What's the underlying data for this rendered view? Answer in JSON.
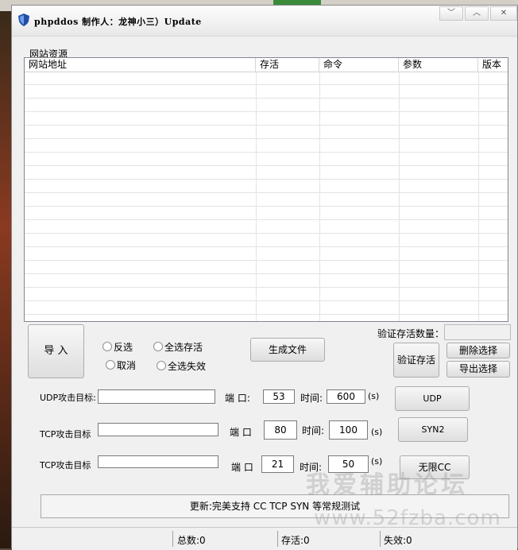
{
  "window": {
    "title": "phpddos 制作人：龙神小三）Update",
    "controls": [
      "minimize",
      "maximize",
      "close"
    ],
    "control_symbols": {
      "minimize": "﹀",
      "maximize": "︿",
      "close": "✕"
    }
  },
  "sites": {
    "group_label": "网站资源",
    "columns": [
      "网站地址",
      "存活",
      "命令",
      "参数",
      "版本"
    ],
    "rows": []
  },
  "actions": {
    "import": "导 入",
    "invert_select": "反选",
    "select_all_alive": "全选存活",
    "cancel": "取消",
    "select_all_failed": "全选失效",
    "generate_file": "生成文件",
    "verify_count_label": "验证存活数量：",
    "verify_count_value": "",
    "verify_alive": "验证存活",
    "delete_selected": "删除选择",
    "export_selected": "导出选择"
  },
  "attacks": {
    "udp": {
      "target_label": "UDP攻击目标:",
      "target": "",
      "port_label": "端  口:",
      "port": "53",
      "time_label": "时间:",
      "time": "600",
      "unit": "(s)",
      "button": "UDP"
    },
    "tcp1": {
      "target_label": "TCP攻击目标",
      "target": "",
      "port_label": "端  口",
      "port": "80",
      "time_label": "时间:",
      "time": "100",
      "unit": "(s)",
      "button": "SYN2"
    },
    "tcp2": {
      "target_label": "TCP攻击目标",
      "target": "",
      "port_label": "端  口",
      "port": "21",
      "time_label": "时间:",
      "time": "50",
      "unit": "(s)",
      "button": "无限CC"
    }
  },
  "notice": "更新:完美支持 CC TCP SYN 等常规测试",
  "status": {
    "total": "总数:0",
    "alive": "存活:0",
    "failed": "失效:0"
  },
  "watermark": {
    "line1": "我爱辅助论坛",
    "line2": "www.52fzba.com"
  },
  "colors": {
    "accent_icon": "#1f4fa8",
    "window_bg": "#f0f0f0"
  }
}
